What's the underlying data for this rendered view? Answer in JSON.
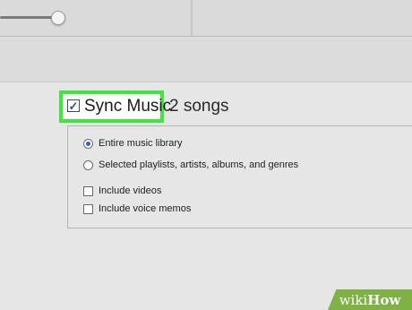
{
  "sync": {
    "label": "Sync Music",
    "checked": true,
    "count": "2 songs"
  },
  "options": {
    "radios": [
      {
        "label": "Entire music library",
        "selected": true
      },
      {
        "label": "Selected playlists, artists, albums, and genres",
        "selected": false
      }
    ],
    "checkboxes": [
      {
        "label": "Include videos",
        "checked": false
      },
      {
        "label": "Include voice memos",
        "checked": false
      }
    ]
  },
  "watermark": {
    "part1": "wiki",
    "part2": "How"
  },
  "colors": {
    "highlight": "#3ee63e",
    "radio_selected": "#2f63c2",
    "watermark_bg": "#7fb244"
  }
}
